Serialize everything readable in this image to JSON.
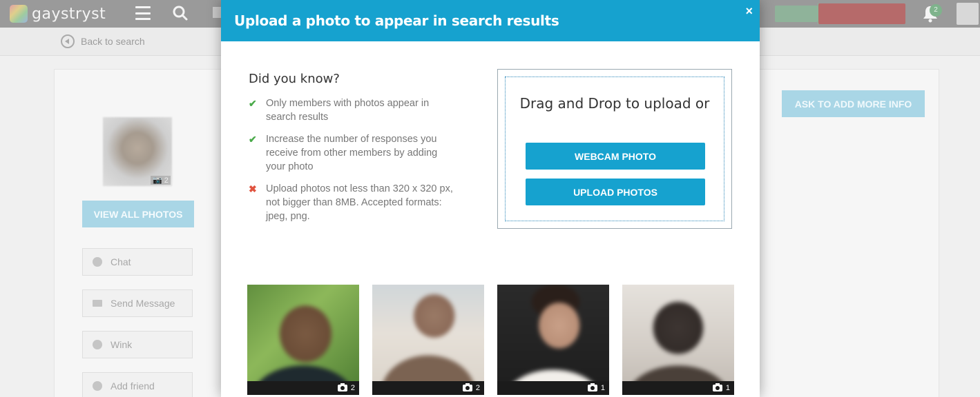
{
  "app": {
    "logo_text": "gaystryst"
  },
  "topbar": {
    "notification_count": "2"
  },
  "subbar": {
    "back_label": "Back to search"
  },
  "profile": {
    "photo_count": "2",
    "view_all_label": "VIEW ALL PHOTOS",
    "ask_more_label": "ASK TO ADD MORE INFO",
    "actions": [
      {
        "label": "Chat",
        "icon": "chat-icon"
      },
      {
        "label": "Send Message",
        "icon": "envelope-icon"
      },
      {
        "label": "Wink",
        "icon": "smiley-icon"
      },
      {
        "label": "Add friend",
        "icon": "add-friend-icon"
      }
    ]
  },
  "modal": {
    "title": "Upload a photo to appear in search results",
    "close_label": "×",
    "did_you_know": "Did you know?",
    "tips": [
      {
        "type": "ok",
        "mark": "✔",
        "text": "Only members with photos appear in search results"
      },
      {
        "type": "ok",
        "mark": "✔",
        "text": "Increase the number of responses you receive from other members by adding your photo"
      },
      {
        "type": "no",
        "mark": "✖",
        "text": "Upload photos not less than 320 x 320 px, not bigger than 8MB. Accepted formats: jpeg, png."
      }
    ],
    "dropzone": {
      "title": "Drag and Drop to upload or",
      "webcam_label": "WEBCAM PHOTO",
      "upload_label": "UPLOAD PHOTOS"
    },
    "thumbnails": [
      {
        "count": "2"
      },
      {
        "count": "2"
      },
      {
        "count": "1"
      },
      {
        "count": "1"
      }
    ]
  },
  "colors": {
    "accent": "#16a2cf",
    "check": "#4aaa4a",
    "cross": "#e0533f"
  }
}
